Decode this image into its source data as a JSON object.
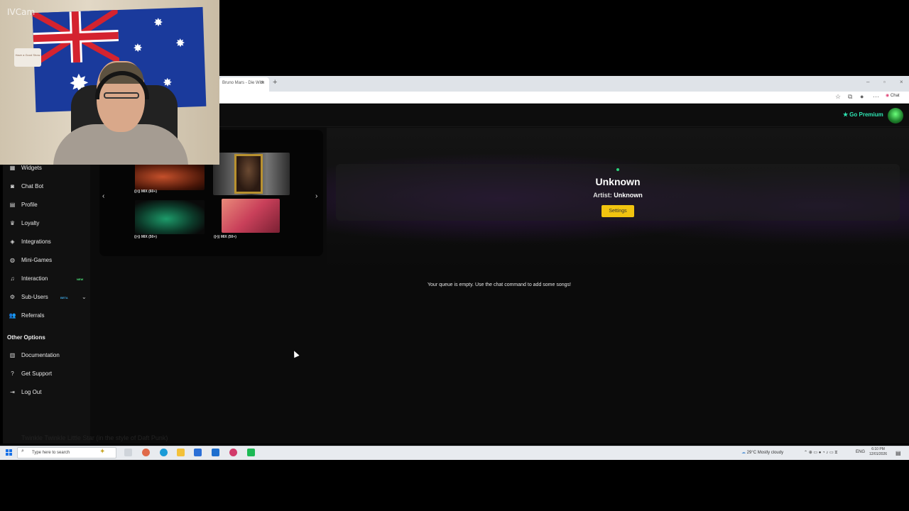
{
  "webcam": {
    "watermark": "IVCam",
    "plaque_text": "Have a Good Show"
  },
  "browser": {
    "tab_title": "Bruno Mars - Die With",
    "new_tab": "+",
    "chat_label": "Chat"
  },
  "header": {
    "go_premium": "Go Premium"
  },
  "sidebar": {
    "items": [
      {
        "label": "Widgets",
        "icon": "grid-icon"
      },
      {
        "label": "Chat Bot",
        "icon": "robot-icon"
      },
      {
        "label": "Profile",
        "icon": "id-card-icon"
      },
      {
        "label": "Loyalty",
        "icon": "trophy-icon"
      },
      {
        "label": "Integrations",
        "icon": "layers-icon"
      },
      {
        "label": "Mini-Games",
        "icon": "gamepad-icon"
      },
      {
        "label": "Interaction",
        "icon": "music-icon",
        "badge": "NEW"
      },
      {
        "label": "Sub-Users",
        "icon": "users-cog-icon",
        "badge": "BETA"
      },
      {
        "label": "Referrals",
        "icon": "users-icon"
      }
    ],
    "other_options_heading": "Other Options",
    "other_items": [
      {
        "label": "Documentation",
        "icon": "book-icon"
      },
      {
        "label": "Get Support",
        "icon": "question-icon"
      },
      {
        "label": "Log Out",
        "icon": "logout-icon"
      }
    ]
  },
  "carousel": {
    "labels": [
      "MIX (60+)",
      "MIX (50+)",
      "MIX (50+)"
    ]
  },
  "player": {
    "title": "Unknown",
    "artist_label": "Artist:",
    "artist_value": "Unknown",
    "settings_button": "Settings"
  },
  "queue": {
    "empty_message": "Your queue is empty. Use the chat command to add some songs!"
  },
  "caption": "Twinkle Twinkle Little Star (in the style of Daft Punk)",
  "taskbar": {
    "search_placeholder": "Type here to search",
    "weather": "29°C  Mostly cloudy",
    "language": "ENG",
    "time": "6:10 PM",
    "date": "12/01/2026"
  },
  "colors": {
    "premium": "#2ee6b3",
    "settings": "#f1c40f",
    "new_badge": "#4ee37a",
    "beta_badge": "#3fa9e6"
  }
}
